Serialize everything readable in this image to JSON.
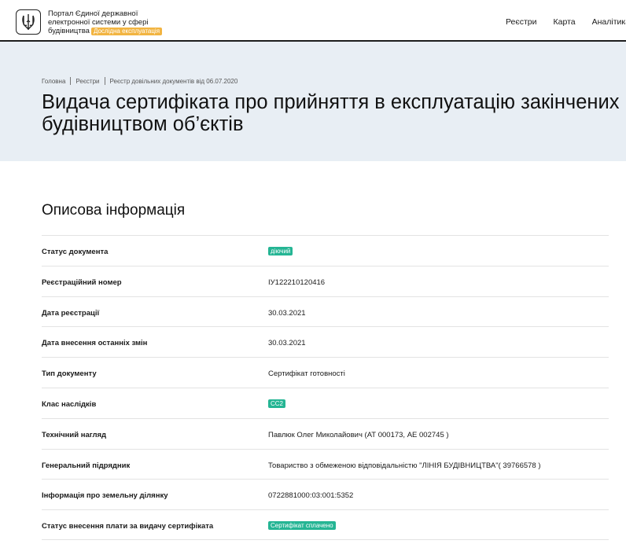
{
  "header": {
    "portal_line1": "Портал Єдиної державної",
    "portal_line2": "електронної системи у сфері",
    "portal_line3": "будівництва",
    "badge": "Дослідна експлуатація",
    "logo_icon": "trident-icon",
    "nav": [
      "Реєстри",
      "Карта",
      "Аналітика"
    ]
  },
  "hero": {
    "breadcrumb": [
      "Головна",
      "Реєстри",
      "Реєстр довільних документів від 06.07.2020"
    ],
    "title_line1": "Видача сертифіката про прийняття в експлуатацію закінчених",
    "title_line2": "будівництвом об’єктів"
  },
  "section": {
    "title": "Описова інформація"
  },
  "rows": [
    {
      "label": "Статус документа",
      "value": "діючий"
    },
    {
      "label": "Реєстраційний номер",
      "value": "ІУ122210120416"
    },
    {
      "label": "Дата реєстрації",
      "value": "30.03.2021"
    },
    {
      "label": "Дата внесення останніх змін",
      "value": "30.03.2021"
    },
    {
      "label": "Тип документу",
      "value": "Сертифікат готовності"
    },
    {
      "label": "Клас наслідків",
      "value": "СС2"
    },
    {
      "label": "Технічний нагляд",
      "value": "Павлюк Олег Миколайович (АТ 000173, АЕ 002745 )"
    },
    {
      "label": "Генеральний підрядник",
      "value": "Товариство з обмеженою відповідальністю \"ЛІНІЯ БУДІВНИЦТВА\"( 39766578 )"
    },
    {
      "label": "Інформація про земельну ділянку",
      "value": "0722881000:03:001:5352"
    },
    {
      "label": "Статус внесення плати за видачу сертифіката",
      "value": "Сертифікат сплачено"
    }
  ],
  "colors": {
    "accent_tag": "#25b594",
    "badge": "#f2b441",
    "hero_bg": "#e8eef4"
  }
}
